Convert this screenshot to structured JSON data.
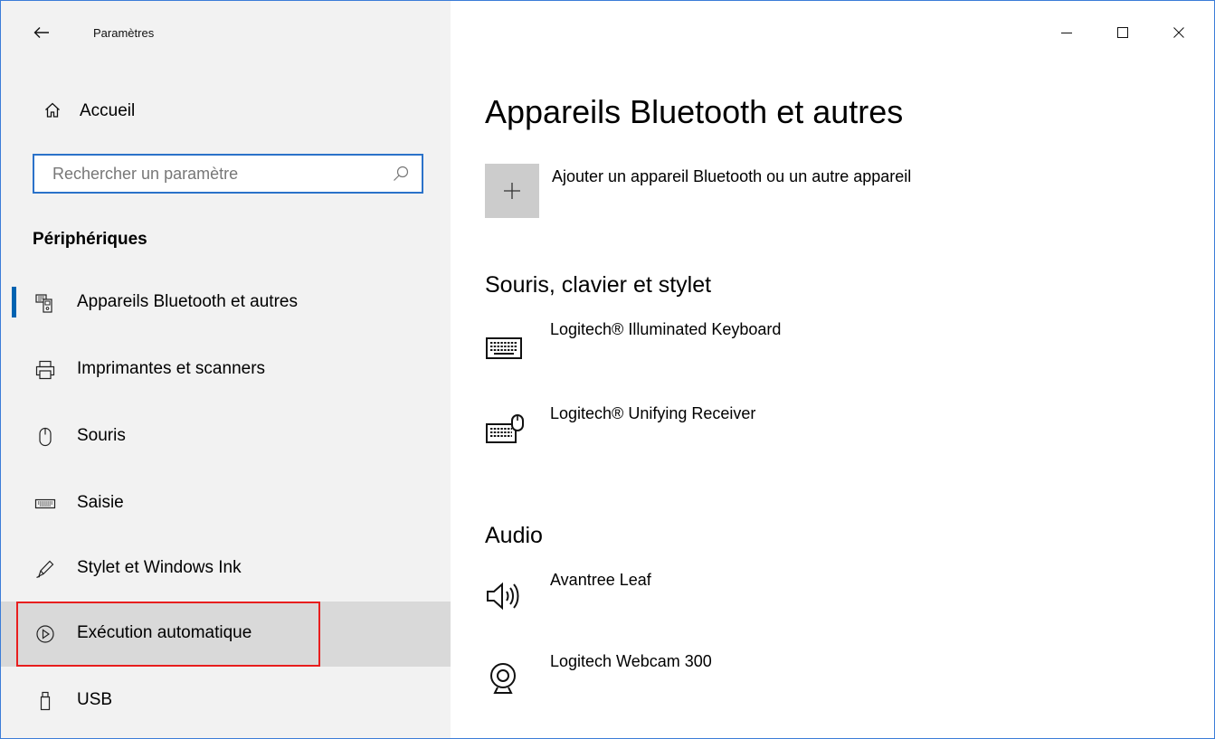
{
  "window": {
    "title": "Paramètres",
    "controls": {
      "minimize": "minimize-icon",
      "maximize": "maximize-icon",
      "close": "close-icon"
    }
  },
  "sidebar": {
    "home_label": "Accueil",
    "search": {
      "placeholder": "Rechercher un paramètre",
      "value": ""
    },
    "section": "Périphériques",
    "items": [
      {
        "label": "Appareils Bluetooth et autres",
        "icon": "bluetooth-devices-icon",
        "selected": true
      },
      {
        "label": "Imprimantes et scanners",
        "icon": "printer-icon"
      },
      {
        "label": "Souris",
        "icon": "mouse-icon"
      },
      {
        "label": "Saisie",
        "icon": "keyboard-icon"
      },
      {
        "label": "Stylet et Windows Ink",
        "icon": "pen-icon"
      },
      {
        "label": "Exécution automatique",
        "icon": "autoplay-icon",
        "hovered": true
      },
      {
        "label": "USB",
        "icon": "usb-icon"
      }
    ]
  },
  "main": {
    "title": "Appareils Bluetooth et autres",
    "add_device_label": "Ajouter un appareil Bluetooth ou un autre appareil",
    "groups": [
      {
        "title": "Souris, clavier et stylet",
        "devices": [
          {
            "name": "Logitech® Illuminated Keyboard",
            "icon": "keyboard-icon"
          },
          {
            "name": "Logitech® Unifying Receiver",
            "icon": "keyboard-mouse-icon"
          }
        ]
      },
      {
        "title": "Audio",
        "devices": [
          {
            "name": "Avantree Leaf",
            "icon": "speaker-icon"
          },
          {
            "name": "Logitech Webcam 300",
            "icon": "webcam-icon"
          }
        ]
      }
    ]
  },
  "colors": {
    "accent": "#0063b1",
    "sidebar_bg": "#f2f2f2",
    "hover_bg": "#d9d9d9",
    "highlight": "#e81e1e",
    "search_border": "#2b72c9"
  }
}
